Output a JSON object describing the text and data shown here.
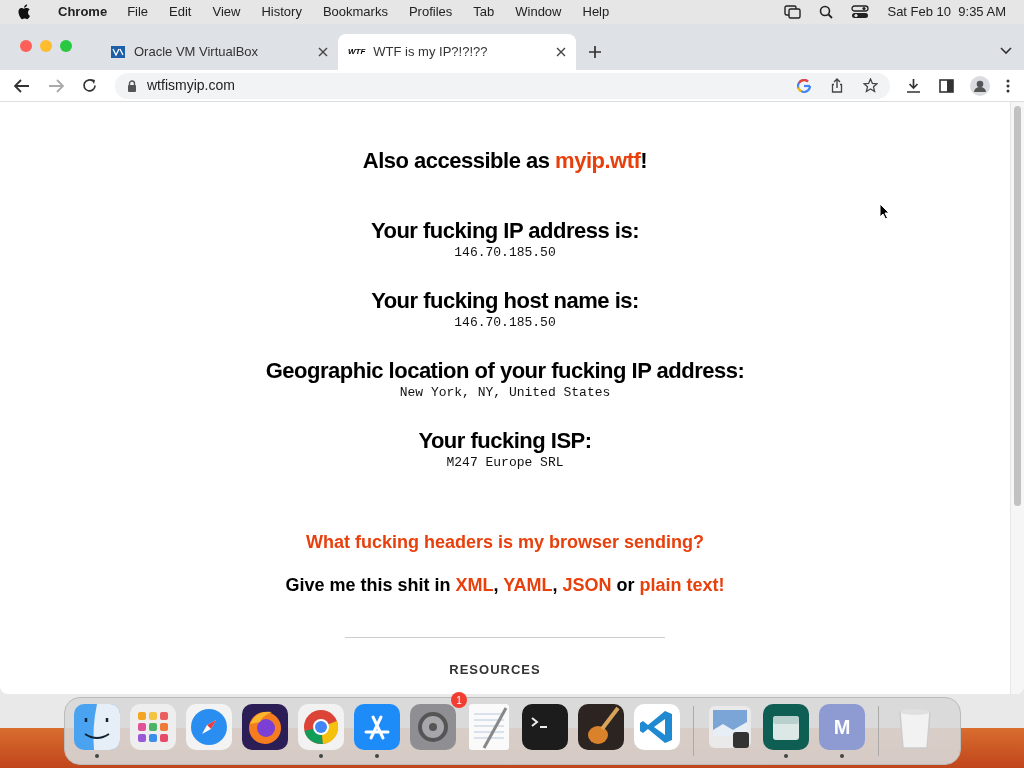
{
  "menu_bar": {
    "app": "Chrome",
    "items": [
      "File",
      "Edit",
      "View",
      "History",
      "Bookmarks",
      "Profiles",
      "Tab",
      "Window",
      "Help"
    ],
    "clock": "Sat Feb 10  9:35 AM"
  },
  "tabs": [
    {
      "title": "Oracle VM VirtualBox",
      "selected": false,
      "kind": "virtualbox"
    },
    {
      "title": "WTF is my IP?!?!??",
      "selected": true,
      "kind": "wtf",
      "favicon_text": "WTF"
    }
  ],
  "address": "wtfismyip.com",
  "page": {
    "also": [
      {
        "text": "Also accessible as ",
        "link": false
      },
      {
        "text": "myip.wtf",
        "link": true
      },
      {
        "text": "!",
        "link": false
      }
    ],
    "sections": [
      {
        "heading": "Your fucking IP address is:",
        "value": "146.70.185.50"
      },
      {
        "heading": "Your fucking host name is:",
        "value": "146.70.185.50"
      },
      {
        "heading": "Geographic location of your fucking IP address:",
        "value": "New York, NY, United States"
      },
      {
        "heading": "Your fucking ISP:",
        "value": "M247 Europe SRL"
      }
    ],
    "headers_link": "What fucking headers is my browser sending?",
    "formats": [
      {
        "text": "Give me this shit in ",
        "link": false
      },
      {
        "text": "XML",
        "link": true
      },
      {
        "text": ", ",
        "link": false
      },
      {
        "text": "YAML",
        "link": true
      },
      {
        "text": ", ",
        "link": false
      },
      {
        "text": "JSON",
        "link": true
      },
      {
        "text": " or ",
        "link": false
      },
      {
        "text": "plain text!",
        "link": true
      }
    ],
    "resources_heading": "RESOURCES"
  },
  "dock": [
    {
      "kind": "finder",
      "running": true
    },
    {
      "kind": "launchpad",
      "running": false
    },
    {
      "kind": "safari",
      "running": false
    },
    {
      "kind": "firefox",
      "running": false
    },
    {
      "kind": "chrome",
      "running": true
    },
    {
      "kind": "appstore",
      "running": true
    },
    {
      "kind": "settings",
      "running": false,
      "badge": "1"
    },
    {
      "kind": "textedit",
      "running": false
    },
    {
      "kind": "terminal",
      "running": false
    },
    {
      "kind": "garageband",
      "running": false
    },
    {
      "kind": "vscode",
      "running": false
    },
    {
      "kind": "sep"
    },
    {
      "kind": "preview",
      "running": false
    },
    {
      "kind": "files",
      "running": true
    },
    {
      "kind": "m",
      "running": true,
      "letter": "M"
    },
    {
      "kind": "sep"
    },
    {
      "kind": "trash",
      "running": false
    }
  ]
}
